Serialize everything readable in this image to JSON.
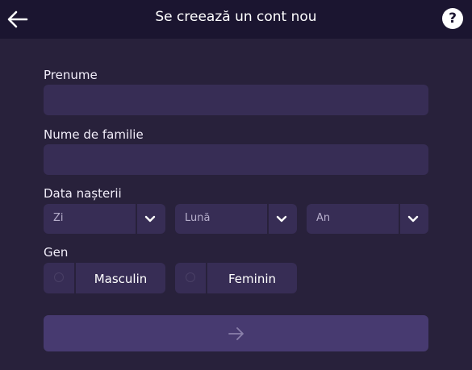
{
  "header": {
    "title": "Se creează un cont nou",
    "back_icon": "arrow-left-icon",
    "help_label": "?"
  },
  "form": {
    "first_name": {
      "label": "Prenume",
      "value": "",
      "placeholder": ""
    },
    "last_name": {
      "label": "Nume de familie",
      "value": "",
      "placeholder": ""
    },
    "birth_date": {
      "label": "Data nașterii",
      "day": "Zi",
      "month": "Lună",
      "year": "An"
    },
    "gender": {
      "label": "Gen",
      "options": [
        "Masculin",
        "Feminin"
      ]
    },
    "submit_icon": "arrow-right-icon"
  },
  "colors": {
    "background": "#28213b",
    "header": "#1b1530",
    "field": "#372d55",
    "button": "#473a70"
  }
}
